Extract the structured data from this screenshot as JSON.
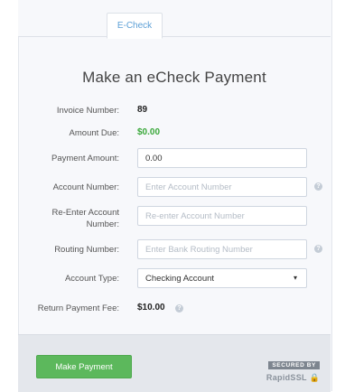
{
  "tabs": [
    {
      "label": "E-Check"
    }
  ],
  "page_title": "Make an eCheck Payment",
  "invoice": {
    "label": "Invoice Number:",
    "value": "89"
  },
  "amount_due": {
    "label": "Amount Due:",
    "value": "$0.00"
  },
  "payment_amount": {
    "label": "Payment Amount:",
    "value": "0.00"
  },
  "account_number": {
    "label": "Account Number:",
    "placeholder": "Enter Account Number"
  },
  "reenter_account": {
    "label_line1": "Re-Enter Account",
    "label_line2": "Number:",
    "placeholder": "Re-enter Account Number"
  },
  "routing_number": {
    "label": "Routing Number:",
    "placeholder": "Enter Bank Routing Number"
  },
  "account_type": {
    "label": "Account Type:",
    "selected": "Checking Account"
  },
  "return_fee": {
    "label": "Return Payment Fee:",
    "value": "$10.00"
  },
  "footer": {
    "submit_label": "Make Payment",
    "secured_by": "SECURED BY",
    "brand": "RapidSSL"
  },
  "colors": {
    "accent": "#5b9fd6",
    "button": "#5cb85c",
    "amount_green": "#3aa83a"
  }
}
